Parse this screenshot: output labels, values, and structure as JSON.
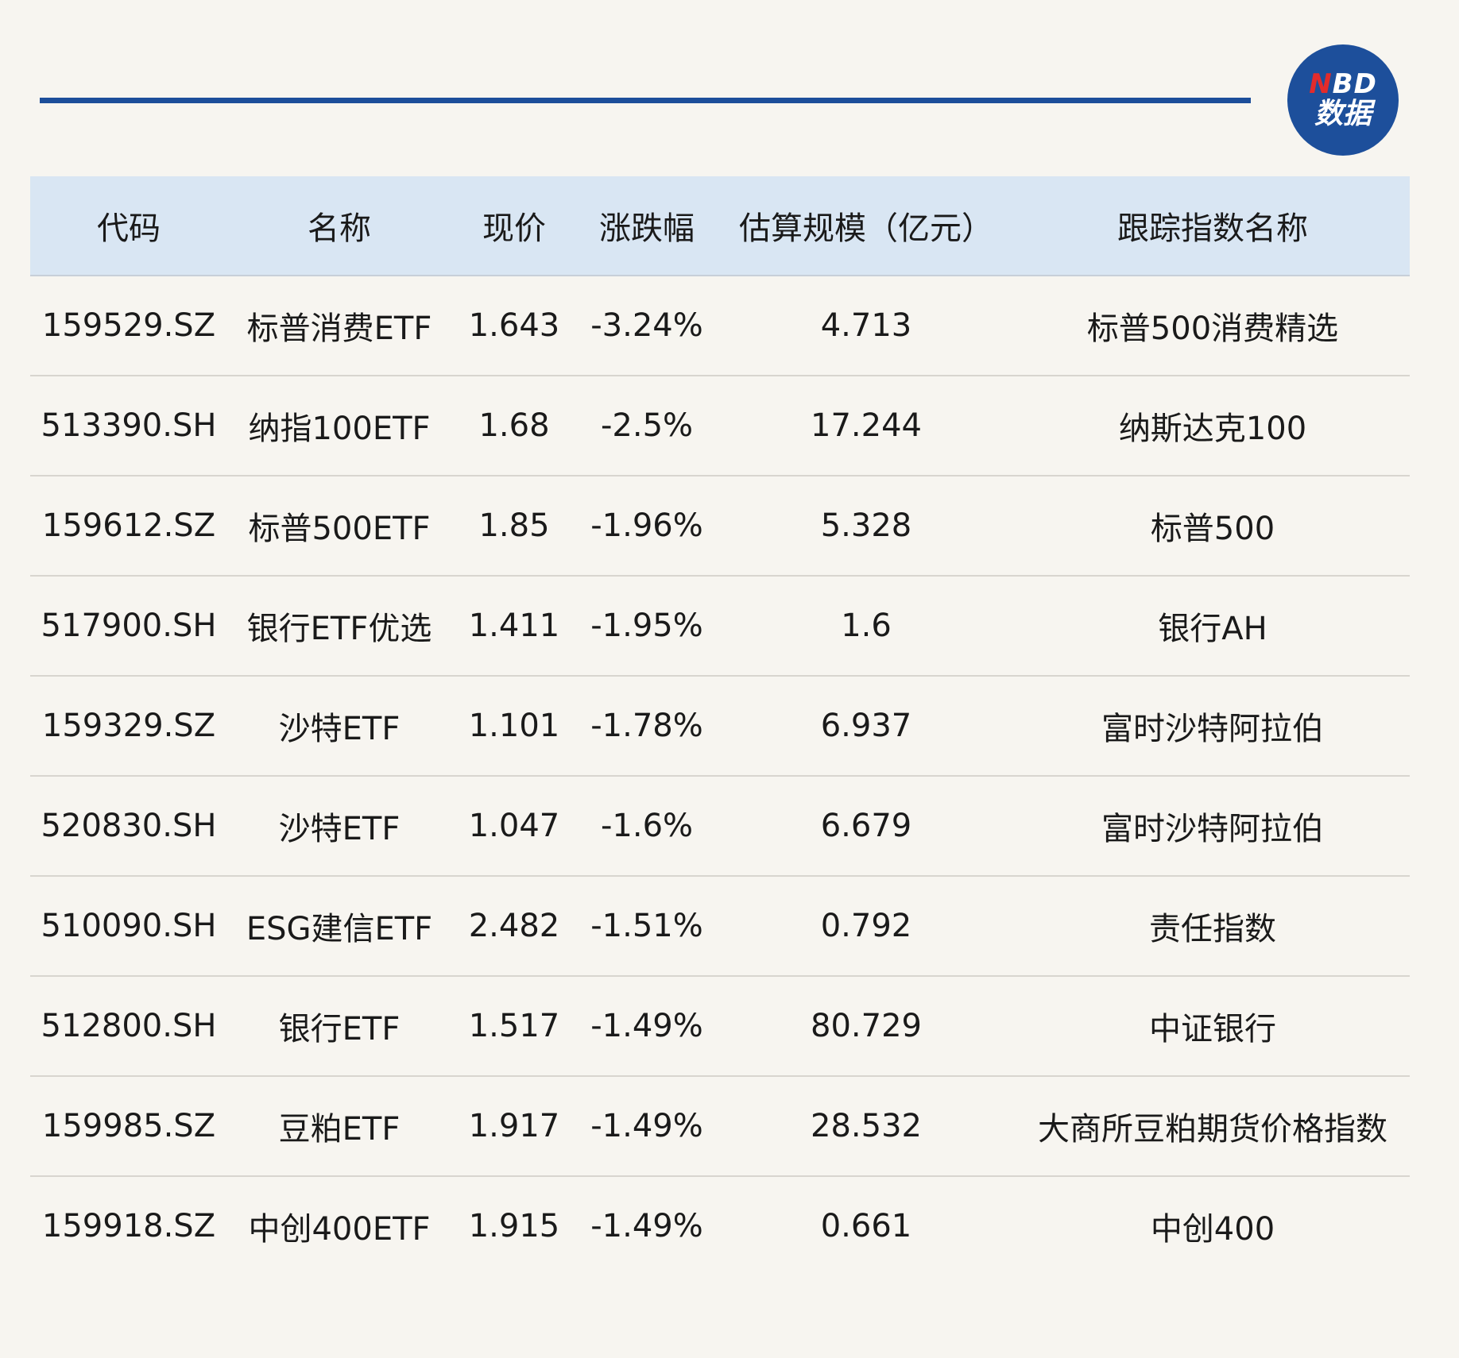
{
  "logo": {
    "line1_n": "N",
    "line1_rest": "BD",
    "line2": "数据"
  },
  "table": {
    "headers": [
      "代码",
      "名称",
      "现价",
      "涨跌幅",
      "估算规模（亿元）",
      "跟踪指数名称"
    ],
    "rows": [
      [
        "159529.SZ",
        "标普消费ETF",
        "1.643",
        "-3.24%",
        "4.713",
        "标普500消费精选"
      ],
      [
        "513390.SH",
        "纳指100ETF",
        "1.68",
        "-2.5%",
        "17.244",
        "纳斯达克100"
      ],
      [
        "159612.SZ",
        "标普500ETF",
        "1.85",
        "-1.96%",
        "5.328",
        "标普500"
      ],
      [
        "517900.SH",
        "银行ETF优选",
        "1.411",
        "-1.95%",
        "1.6",
        "银行AH"
      ],
      [
        "159329.SZ",
        "沙特ETF",
        "1.101",
        "-1.78%",
        "6.937",
        "富时沙特阿拉伯"
      ],
      [
        "520830.SH",
        "沙特ETF",
        "1.047",
        "-1.6%",
        "6.679",
        "富时沙特阿拉伯"
      ],
      [
        "510090.SH",
        "ESG建信ETF",
        "2.482",
        "-1.51%",
        "0.792",
        "责任指数"
      ],
      [
        "512800.SH",
        "银行ETF",
        "1.517",
        "-1.49%",
        "80.729",
        "中证银行"
      ],
      [
        "159985.SZ",
        "豆粕ETF",
        "1.917",
        "-1.49%",
        "28.532",
        "大商所豆粕期货价格指数"
      ],
      [
        "159918.SZ",
        "中创400ETF",
        "1.915",
        "-1.49%",
        "0.661",
        "中创400"
      ]
    ]
  }
}
